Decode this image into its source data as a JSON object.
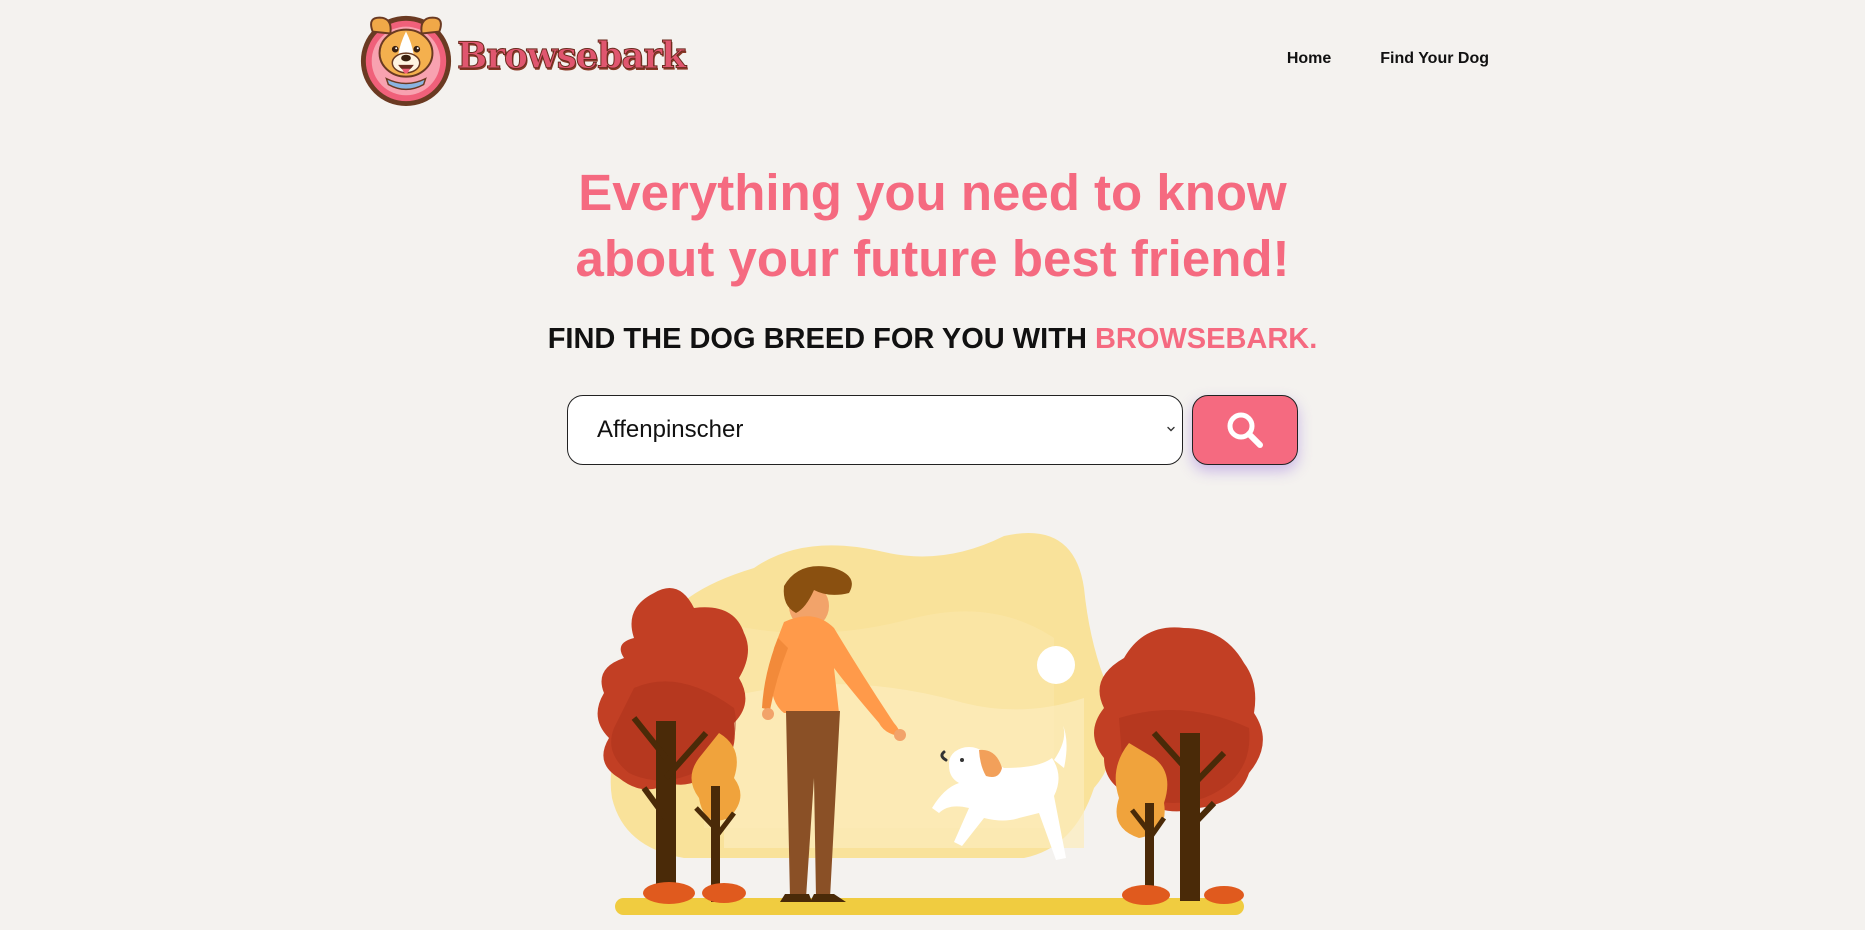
{
  "header": {
    "logo_text": "Browsebark",
    "nav": [
      {
        "label": "Home"
      },
      {
        "label": "Find Your Dog"
      }
    ]
  },
  "hero": {
    "title_line1": "Everything you need to know",
    "title_line2": "about your future best friend!",
    "subtitle_prefix": "FIND THE DOG BREED FOR YOU WITH ",
    "subtitle_brand": "BROWSEBARK."
  },
  "search": {
    "selected_breed": "Affenpinscher"
  },
  "colors": {
    "background": "#f4f2ef",
    "accent_pink": "#f56a80",
    "text_dark": "#111111"
  },
  "icons": {
    "search_button": "search-icon",
    "select_toggle": "chevron-down-icon"
  }
}
